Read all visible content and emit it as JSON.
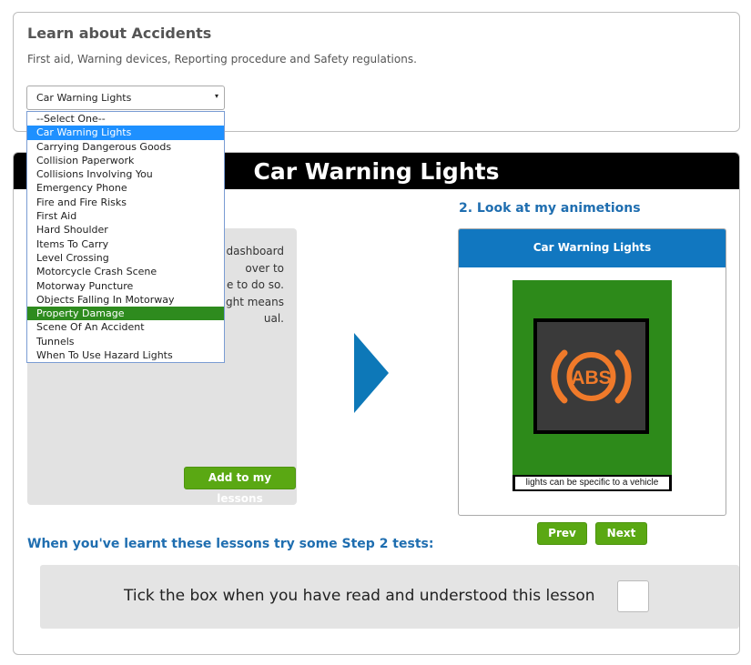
{
  "top_panel": {
    "title": "Learn about Accidents",
    "subtitle": "First aid, Warning devices, Reporting procedure and Safety regulations.",
    "select": {
      "value": "Car Warning Lights",
      "caret": "▾",
      "options": [
        "--Select One--",
        "Car Warning Lights",
        "Carrying Dangerous Goods",
        "Collision Paperwork",
        "Collisions Involving You",
        "Emergency Phone",
        "Fire and Fire Risks",
        "First Aid",
        "Hard Shoulder",
        "Items To Carry",
        "Level Crossing",
        "Motorcycle Crash Scene",
        "Motorway Puncture",
        "Objects Falling In Motorway",
        "Property Damage",
        "Scene Of An Accident",
        "Tunnels",
        "When To Use Hazard Lights"
      ],
      "selected_index": 1,
      "hover_index": 14
    }
  },
  "lesson": {
    "banner_title": "Car Warning Lights",
    "text_lines": [
      "dashboard",
      "over to",
      "e to do so.",
      "ght means",
      "ual."
    ],
    "add_button": "Add to my lessons"
  },
  "animation": {
    "heading": "2. Look at my animetions",
    "header": "Car Warning Lights",
    "icon_text": "ABS",
    "caption": "lights can be specific to a vehicle",
    "prev_label": "Prev",
    "next_label": "Next"
  },
  "tests_heading": "When you've learnt these lessons try some Step 2 tests:",
  "tick": {
    "label": "Tick the box when you have read and understood this lesson",
    "checked": false
  },
  "colors": {
    "accent_blue": "#1f6eb0",
    "header_blue": "#1177c0",
    "button_green": "#5aa813",
    "abs_orange": "#f07a2a",
    "dropdown_selected": "#1e90ff",
    "dropdown_hover": "#2e8b1e"
  }
}
